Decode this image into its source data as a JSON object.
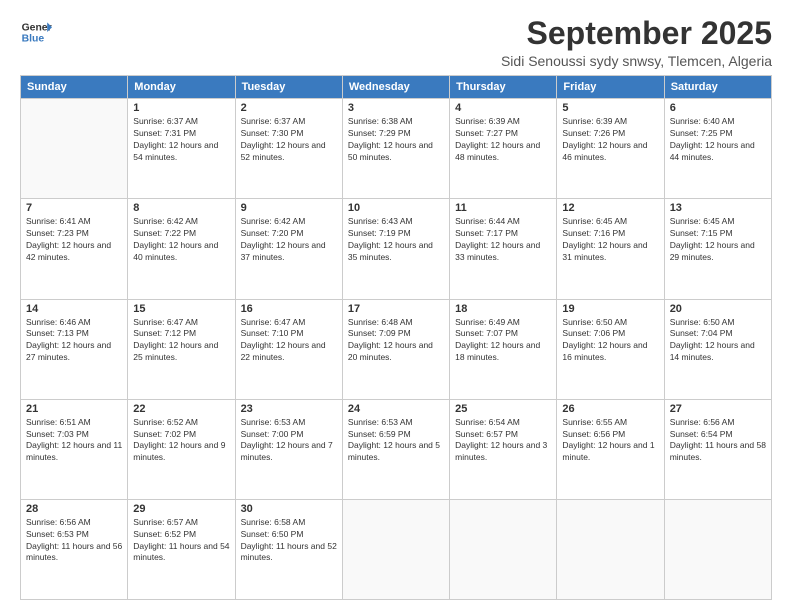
{
  "header": {
    "logo_line1": "General",
    "logo_line2": "Blue",
    "month": "September 2025",
    "location": "Sidi Senoussi sydy snwsy, Tlemcen, Algeria"
  },
  "weekdays": [
    "Sunday",
    "Monday",
    "Tuesday",
    "Wednesday",
    "Thursday",
    "Friday",
    "Saturday"
  ],
  "weeks": [
    [
      {
        "day": "",
        "sunrise": "",
        "sunset": "",
        "daylight": ""
      },
      {
        "day": "1",
        "sunrise": "Sunrise: 6:37 AM",
        "sunset": "Sunset: 7:31 PM",
        "daylight": "Daylight: 12 hours and 54 minutes."
      },
      {
        "day": "2",
        "sunrise": "Sunrise: 6:37 AM",
        "sunset": "Sunset: 7:30 PM",
        "daylight": "Daylight: 12 hours and 52 minutes."
      },
      {
        "day": "3",
        "sunrise": "Sunrise: 6:38 AM",
        "sunset": "Sunset: 7:29 PM",
        "daylight": "Daylight: 12 hours and 50 minutes."
      },
      {
        "day": "4",
        "sunrise": "Sunrise: 6:39 AM",
        "sunset": "Sunset: 7:27 PM",
        "daylight": "Daylight: 12 hours and 48 minutes."
      },
      {
        "day": "5",
        "sunrise": "Sunrise: 6:39 AM",
        "sunset": "Sunset: 7:26 PM",
        "daylight": "Daylight: 12 hours and 46 minutes."
      },
      {
        "day": "6",
        "sunrise": "Sunrise: 6:40 AM",
        "sunset": "Sunset: 7:25 PM",
        "daylight": "Daylight: 12 hours and 44 minutes."
      }
    ],
    [
      {
        "day": "7",
        "sunrise": "Sunrise: 6:41 AM",
        "sunset": "Sunset: 7:23 PM",
        "daylight": "Daylight: 12 hours and 42 minutes."
      },
      {
        "day": "8",
        "sunrise": "Sunrise: 6:42 AM",
        "sunset": "Sunset: 7:22 PM",
        "daylight": "Daylight: 12 hours and 40 minutes."
      },
      {
        "day": "9",
        "sunrise": "Sunrise: 6:42 AM",
        "sunset": "Sunset: 7:20 PM",
        "daylight": "Daylight: 12 hours and 37 minutes."
      },
      {
        "day": "10",
        "sunrise": "Sunrise: 6:43 AM",
        "sunset": "Sunset: 7:19 PM",
        "daylight": "Daylight: 12 hours and 35 minutes."
      },
      {
        "day": "11",
        "sunrise": "Sunrise: 6:44 AM",
        "sunset": "Sunset: 7:17 PM",
        "daylight": "Daylight: 12 hours and 33 minutes."
      },
      {
        "day": "12",
        "sunrise": "Sunrise: 6:45 AM",
        "sunset": "Sunset: 7:16 PM",
        "daylight": "Daylight: 12 hours and 31 minutes."
      },
      {
        "day": "13",
        "sunrise": "Sunrise: 6:45 AM",
        "sunset": "Sunset: 7:15 PM",
        "daylight": "Daylight: 12 hours and 29 minutes."
      }
    ],
    [
      {
        "day": "14",
        "sunrise": "Sunrise: 6:46 AM",
        "sunset": "Sunset: 7:13 PM",
        "daylight": "Daylight: 12 hours and 27 minutes."
      },
      {
        "day": "15",
        "sunrise": "Sunrise: 6:47 AM",
        "sunset": "Sunset: 7:12 PM",
        "daylight": "Daylight: 12 hours and 25 minutes."
      },
      {
        "day": "16",
        "sunrise": "Sunrise: 6:47 AM",
        "sunset": "Sunset: 7:10 PM",
        "daylight": "Daylight: 12 hours and 22 minutes."
      },
      {
        "day": "17",
        "sunrise": "Sunrise: 6:48 AM",
        "sunset": "Sunset: 7:09 PM",
        "daylight": "Daylight: 12 hours and 20 minutes."
      },
      {
        "day": "18",
        "sunrise": "Sunrise: 6:49 AM",
        "sunset": "Sunset: 7:07 PM",
        "daylight": "Daylight: 12 hours and 18 minutes."
      },
      {
        "day": "19",
        "sunrise": "Sunrise: 6:50 AM",
        "sunset": "Sunset: 7:06 PM",
        "daylight": "Daylight: 12 hours and 16 minutes."
      },
      {
        "day": "20",
        "sunrise": "Sunrise: 6:50 AM",
        "sunset": "Sunset: 7:04 PM",
        "daylight": "Daylight: 12 hours and 14 minutes."
      }
    ],
    [
      {
        "day": "21",
        "sunrise": "Sunrise: 6:51 AM",
        "sunset": "Sunset: 7:03 PM",
        "daylight": "Daylight: 12 hours and 11 minutes."
      },
      {
        "day": "22",
        "sunrise": "Sunrise: 6:52 AM",
        "sunset": "Sunset: 7:02 PM",
        "daylight": "Daylight: 12 hours and 9 minutes."
      },
      {
        "day": "23",
        "sunrise": "Sunrise: 6:53 AM",
        "sunset": "Sunset: 7:00 PM",
        "daylight": "Daylight: 12 hours and 7 minutes."
      },
      {
        "day": "24",
        "sunrise": "Sunrise: 6:53 AM",
        "sunset": "Sunset: 6:59 PM",
        "daylight": "Daylight: 12 hours and 5 minutes."
      },
      {
        "day": "25",
        "sunrise": "Sunrise: 6:54 AM",
        "sunset": "Sunset: 6:57 PM",
        "daylight": "Daylight: 12 hours and 3 minutes."
      },
      {
        "day": "26",
        "sunrise": "Sunrise: 6:55 AM",
        "sunset": "Sunset: 6:56 PM",
        "daylight": "Daylight: 12 hours and 1 minute."
      },
      {
        "day": "27",
        "sunrise": "Sunrise: 6:56 AM",
        "sunset": "Sunset: 6:54 PM",
        "daylight": "Daylight: 11 hours and 58 minutes."
      }
    ],
    [
      {
        "day": "28",
        "sunrise": "Sunrise: 6:56 AM",
        "sunset": "Sunset: 6:53 PM",
        "daylight": "Daylight: 11 hours and 56 minutes."
      },
      {
        "day": "29",
        "sunrise": "Sunrise: 6:57 AM",
        "sunset": "Sunset: 6:52 PM",
        "daylight": "Daylight: 11 hours and 54 minutes."
      },
      {
        "day": "30",
        "sunrise": "Sunrise: 6:58 AM",
        "sunset": "Sunset: 6:50 PM",
        "daylight": "Daylight: 11 hours and 52 minutes."
      },
      {
        "day": "",
        "sunrise": "",
        "sunset": "",
        "daylight": ""
      },
      {
        "day": "",
        "sunrise": "",
        "sunset": "",
        "daylight": ""
      },
      {
        "day": "",
        "sunrise": "",
        "sunset": "",
        "daylight": ""
      },
      {
        "day": "",
        "sunrise": "",
        "sunset": "",
        "daylight": ""
      }
    ]
  ]
}
